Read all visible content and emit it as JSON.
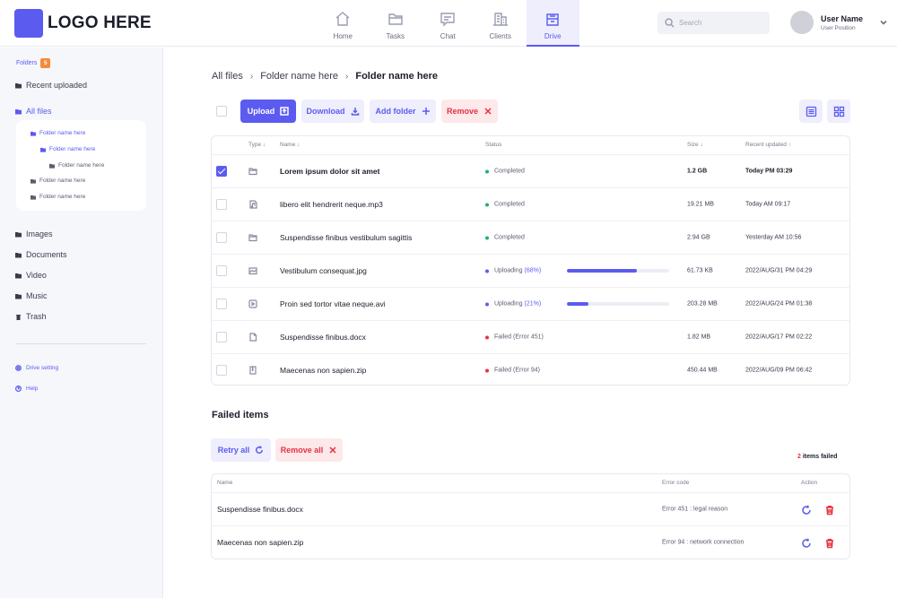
{
  "header": {
    "logo_text": "LOGO HERE",
    "nav": [
      {
        "label": "Home",
        "icon": "home-icon"
      },
      {
        "label": "Tasks",
        "icon": "folder-icon"
      },
      {
        "label": "Chat",
        "icon": "chat-icon"
      },
      {
        "label": "Clients",
        "icon": "building-icon"
      },
      {
        "label": "Drive",
        "icon": "drive-icon",
        "active": true
      }
    ],
    "search_placeholder": "Search",
    "user_name": "User Name",
    "user_position": "User Position"
  },
  "sidebar": {
    "folders_label": "Folders",
    "folders_count": "5",
    "recent": "Recent uploaded",
    "all_files": "All files",
    "tree": [
      {
        "label": "Folder name here",
        "level": 0
      },
      {
        "label": "Folder name here",
        "level": 1
      },
      {
        "label": "Folder name here",
        "level": 2
      },
      {
        "label": "Folder name here",
        "level": 0
      },
      {
        "label": "Folder name here",
        "level": 0
      }
    ],
    "categories": [
      "Images",
      "Documents",
      "Video",
      "Music",
      "Trash"
    ],
    "drive_setting": "Drive setting",
    "help": "Help"
  },
  "breadcrumb": [
    "All files",
    "Folder name here",
    "Folder name here"
  ],
  "toolbar": {
    "upload": "Upload",
    "download": "Download",
    "add_folder": "Add folder",
    "remove": "Remove"
  },
  "files_table": {
    "headers": {
      "type": "Type ↓",
      "name": "Name ↓",
      "status": "Status",
      "size": "Size ↓",
      "recent": "Recent updated ↑"
    },
    "rows": [
      {
        "name": "Lorem ipsum dolor sit amet",
        "icon": "folder-icon",
        "status": "Completed",
        "status_color": "#1fb26b",
        "size": "1.2 GB",
        "date": "Today PM 03:29",
        "checked": true,
        "bold": true
      },
      {
        "name": "libero elit hendrerit neque.mp3",
        "icon": "music-file-icon",
        "status": "Completed",
        "status_color": "#1fb26b",
        "size": "19.21 MB",
        "date": "Today AM 09:17"
      },
      {
        "name": "Suspendisse finibus vestibulum sagittis",
        "icon": "folder-icon",
        "status": "Completed",
        "status_color": "#1fb26b",
        "size": "2.94 GB",
        "date": "Yesterday AM 10:56"
      },
      {
        "name": "Vestibulum consequat.jpg",
        "icon": "image-file-icon",
        "status": "Uploading",
        "status_pct": "(68%)",
        "progress": 0.68,
        "status_color": "#5b5bf0",
        "size": "61.73 KB",
        "date": "2022/AUG/31 PM 04:29"
      },
      {
        "name": "Proin sed tortor vitae neque.avi",
        "icon": "video-file-icon",
        "status": "Uploading",
        "status_pct": "(21%)",
        "progress": 0.21,
        "status_color": "#5b5bf0",
        "size": "203.28 MB",
        "date": "2022/AUG/24 PM 01:38"
      },
      {
        "name": "Suspendisse finibus.docx",
        "icon": "document-file-icon",
        "status": "Failed (Error 451)",
        "status_color": "#e8303f",
        "size": "1.82 MB",
        "date": "2022/AUG/17 PM 02:22"
      },
      {
        "name": "Maecenas non sapien.zip",
        "icon": "zip-file-icon",
        "status": "Failed (Error 94)",
        "status_color": "#e8303f",
        "size": "450.44 MB",
        "date": "2022/AUG/09 PM 06:42"
      }
    ]
  },
  "failed": {
    "title": "Failed items",
    "retry_all": "Retry all",
    "remove_all": "Remove all",
    "count": "2",
    "count_label": "items failed",
    "headers": {
      "name": "Name",
      "code": "Error code",
      "action": "Action"
    },
    "rows": [
      {
        "name": "Suspendisse finibus.docx",
        "code": "Error 451 : legal reason"
      },
      {
        "name": "Maecenas non sapien.zip",
        "code": "Error 94 : network connection"
      }
    ]
  },
  "colors": {
    "accent": "#5b5bf0",
    "danger": "#e8303f",
    "success": "#1fb26b",
    "badge": "#f58a3a"
  }
}
